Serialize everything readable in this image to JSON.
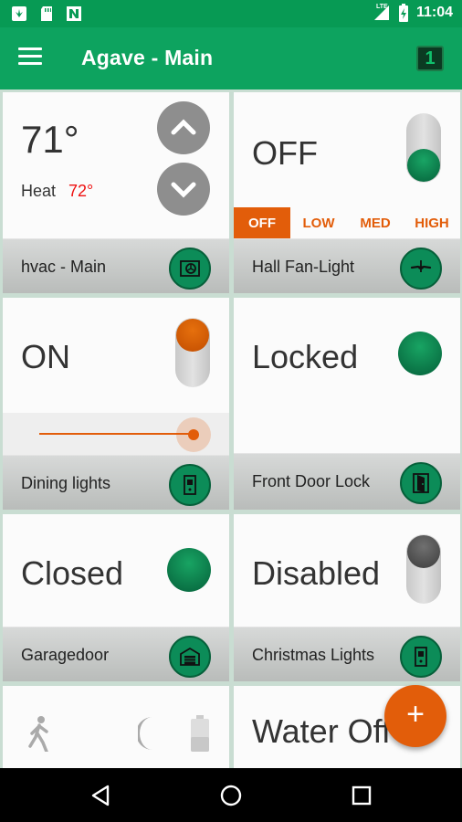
{
  "status_bar": {
    "time": "11:04",
    "network": "LTE",
    "left_icons": [
      "plant-notification-icon",
      "sd-card-icon",
      "n-notification-icon"
    ],
    "right_icons": [
      "signal-icon",
      "battery-icon"
    ]
  },
  "app_bar": {
    "title": "Agave - Main",
    "page_number": "1",
    "menu_icon": "hamburger-menu-icon"
  },
  "tiles": {
    "hvac": {
      "temperature": "71°",
      "mode_label": "Heat",
      "setpoint": "72°",
      "name": "hvac - Main",
      "icon": "hvac-icon"
    },
    "fan": {
      "state": "OFF",
      "speeds": [
        "OFF",
        "LOW",
        "MED",
        "HIGH"
      ],
      "selected_speed": "OFF",
      "name": "Hall Fan-Light",
      "icon": "ceiling-fan-icon"
    },
    "dining": {
      "state": "ON",
      "level": 1.0,
      "name": "Dining lights",
      "icon": "light-switch-icon"
    },
    "door": {
      "state": "Locked",
      "name": "Front Door Lock",
      "icon": "door-icon"
    },
    "garage": {
      "state": "Closed",
      "name": "Garagedoor",
      "icon": "garage-icon"
    },
    "christmas": {
      "state": "Disabled",
      "name": "Christmas Lights",
      "icon": "light-switch-icon"
    },
    "sensor": {
      "icons": [
        "motion-person-icon",
        "moon-icon",
        "battery-icon"
      ]
    },
    "water": {
      "state": "Water Off"
    }
  },
  "fab": {
    "label": "+"
  },
  "colors": {
    "primary": "#0da35f",
    "status": "#079a54",
    "accent": "#e25d0a",
    "alert": "#ee1111"
  }
}
